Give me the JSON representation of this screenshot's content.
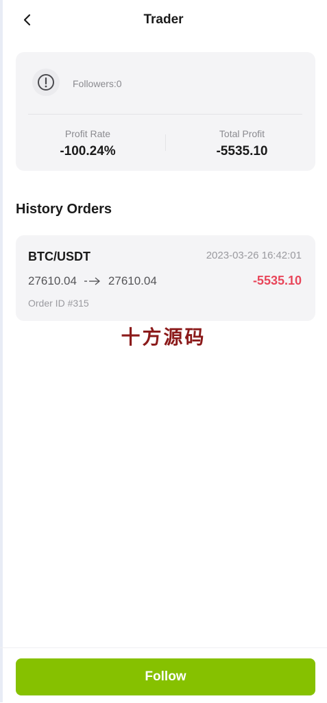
{
  "header": {
    "title": "Trader"
  },
  "trader": {
    "followers_text": "Followers:0",
    "profit_rate_label": "Profit Rate",
    "profit_rate_value": "-100.24%",
    "total_profit_label": "Total Profit",
    "total_profit_value": "-5535.10"
  },
  "history": {
    "title": "History Orders",
    "orders": [
      {
        "pair": "BTC/USDT",
        "datetime": "2023-03-26 16:42:01",
        "open_price": "27610.04",
        "close_price": "27610.04",
        "profit": "-5535.10",
        "order_id": "Order ID #315"
      }
    ]
  },
  "watermark_text": "十方源码",
  "footer": {
    "follow_label": "Follow"
  },
  "colors": {
    "accent": "#86c100",
    "loss": "#e8465a",
    "watermark": "#8b1a1a"
  }
}
